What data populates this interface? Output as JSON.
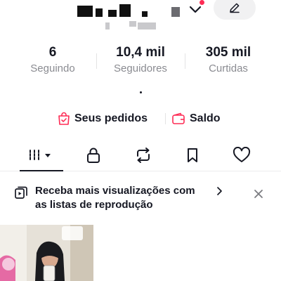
{
  "stats": [
    {
      "value": "6",
      "label": "Seguindo"
    },
    {
      "value": "10,4 mil",
      "label": "Seguidores"
    },
    {
      "value": "305 mil",
      "label": "Curtidas"
    }
  ],
  "commerce": {
    "orders_label": "Seus pedidos",
    "balance_label": "Saldo",
    "accent_color": "#fe2c55"
  },
  "tabs": [
    {
      "icon": "grid-icon",
      "active": true
    },
    {
      "icon": "lock-icon",
      "active": false
    },
    {
      "icon": "repost-icon",
      "active": false
    },
    {
      "icon": "bookmark-icon",
      "active": false
    },
    {
      "icon": "heart-icon",
      "active": false
    }
  ],
  "banner": {
    "line1": "Receba mais visualizações com",
    "line2": "as listas de reprodução"
  },
  "colors": {
    "text": "#161823",
    "secondary": "#8a8b91",
    "notification": "#fe2c55"
  }
}
